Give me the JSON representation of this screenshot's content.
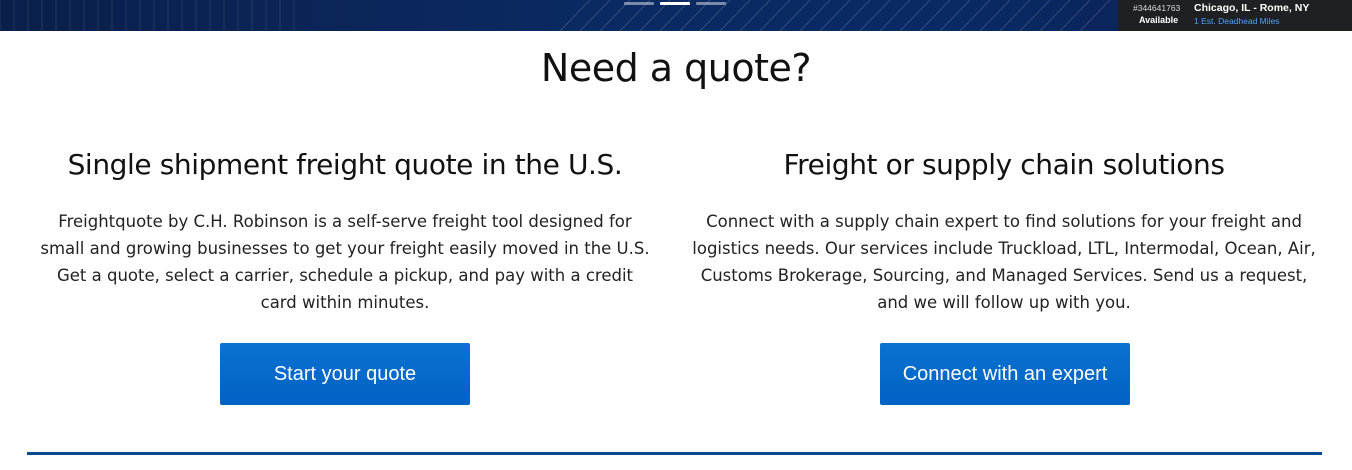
{
  "hero": {
    "carousel": {
      "slides": 3,
      "active_index": 1
    },
    "load_card": {
      "load_id": "#344641763",
      "route": "Chicago, IL - Rome, NY",
      "status": "Available",
      "deadhead": "1 Est. Deadhead Miles"
    }
  },
  "title": "Need a quote?",
  "left": {
    "heading": "Single shipment freight quote in the U.S.",
    "text": "Freightquote by C.H. Robinson is a self-serve freight tool designed for small and growing businesses to get your freight easily moved in the U.S. Get a quote, select a carrier, schedule a pickup, and pay with a credit card within minutes.",
    "button_label": "Start your quote"
  },
  "right": {
    "heading": "Freight or supply chain solutions",
    "text": "Connect with a supply chain expert to find solutions for your freight and logistics needs. Our services include Truckload, LTL, Intermodal, Ocean, Air, Customs Brokerage, Sourcing, and Managed Services. Send us a request, and we will follow up with you.",
    "button_label": "Connect with an expert"
  },
  "colors": {
    "hero_bg": "#0b2a63",
    "button_bg": "#0066cc",
    "rule": "#0a4a8f"
  }
}
